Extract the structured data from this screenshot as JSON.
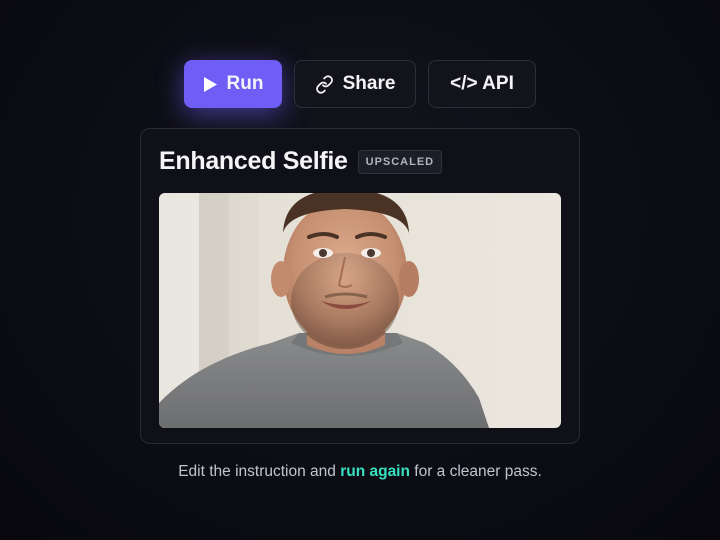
{
  "toolbar": {
    "run": {
      "label": "Run",
      "icon": "play-icon"
    },
    "share": {
      "label": "Share",
      "icon": "link-icon"
    },
    "api": {
      "label": "</> API"
    }
  },
  "card": {
    "title": "Enhanced Selfie",
    "badge": "UPSCALED"
  },
  "caption": {
    "before": "Edit the instruction and ",
    "highlight": "run again",
    "after": " for a cleaner pass."
  },
  "colors": {
    "accent": "#6e5ef5",
    "highlight": "#38e2c0",
    "background": "#0c0c14"
  }
}
